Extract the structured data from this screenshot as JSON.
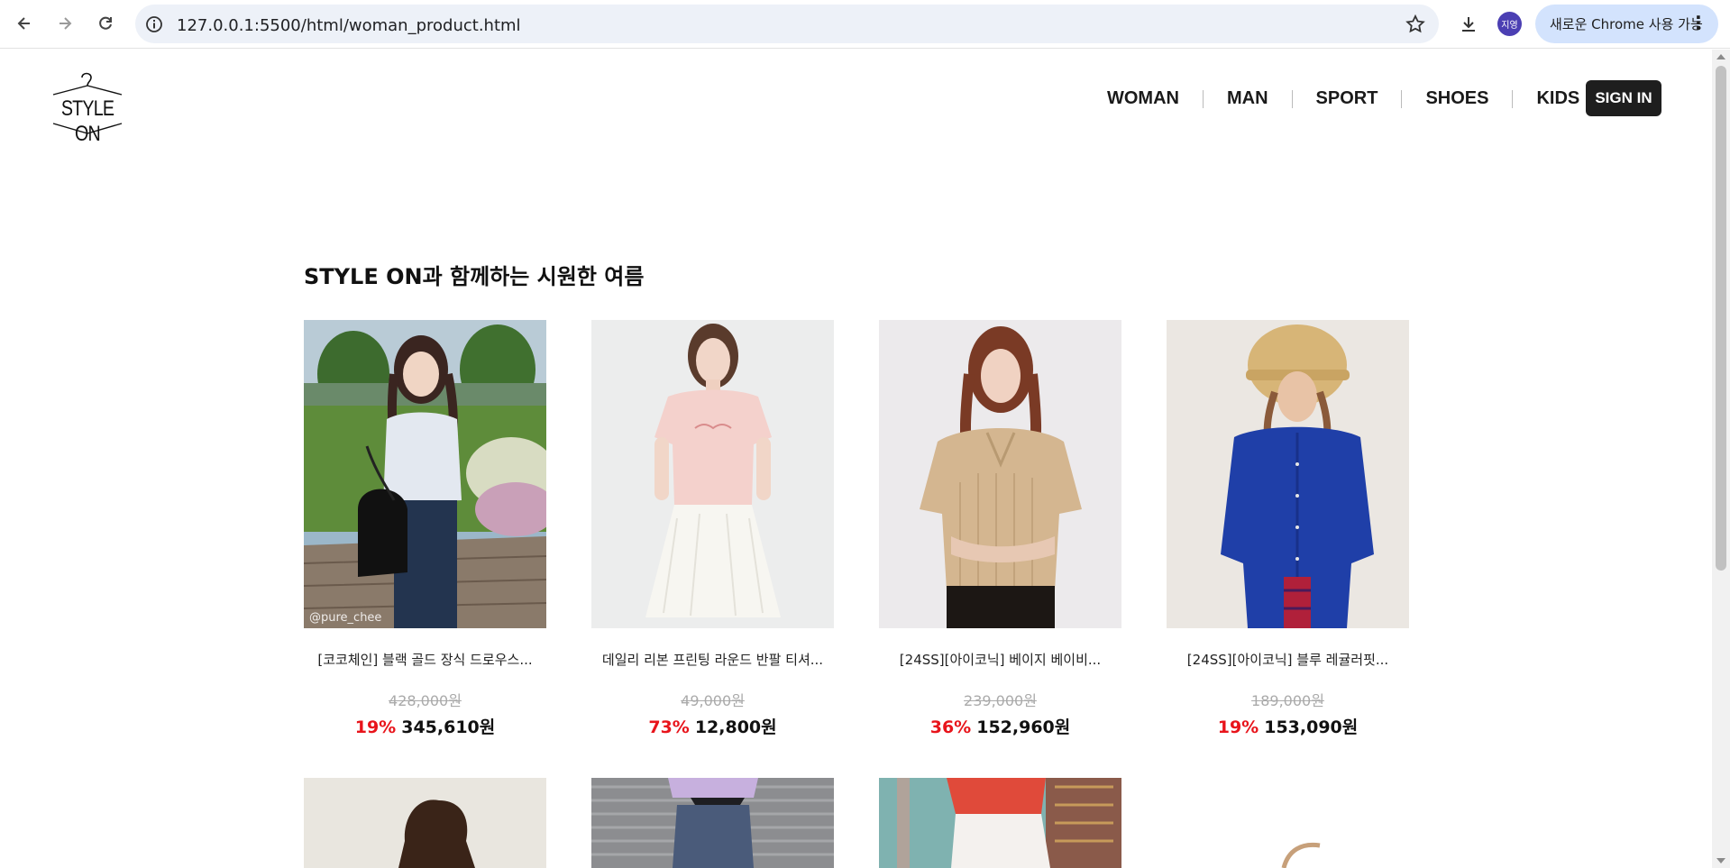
{
  "browser": {
    "url": "127.0.0.1:5500/html/woman_product.html",
    "profile_initials": "지영",
    "chrome_update_label": "새로운 Chrome 사용 가능"
  },
  "header": {
    "logo_text": "STYLE ON",
    "nav": [
      "WOMAN",
      "MAN",
      "SPORT",
      "SHOES",
      "KIDS"
    ],
    "signin_label": "SIGN IN"
  },
  "section": {
    "title": "STYLE ON과 함께하는 시원한 여름"
  },
  "products": [
    {
      "name": "[코코체인] 블랙 골드 장식 드로우스...",
      "original_price": "428,000원",
      "discount": "19%",
      "price": "345,610원",
      "watermark": "@pure_chee"
    },
    {
      "name": "데일리 리본 프린팅 라운드 반팔 티셔...",
      "original_price": "49,000원",
      "discount": "73%",
      "price": "12,800원"
    },
    {
      "name": "[24SS][아이코닉] 베이지 베이비...",
      "original_price": "239,000원",
      "discount": "36%",
      "price": "152,960원"
    },
    {
      "name": "[24SS][아이코닉] 블루 레귤러핏...",
      "original_price": "189,000원",
      "discount": "19%",
      "price": "153,090원"
    }
  ],
  "colors": {
    "discount": "#e8141b",
    "signin_bg": "#1e1e1e",
    "omnibox_bg": "#edf1f8",
    "chrome_pill_bg": "#d3e3fd"
  }
}
